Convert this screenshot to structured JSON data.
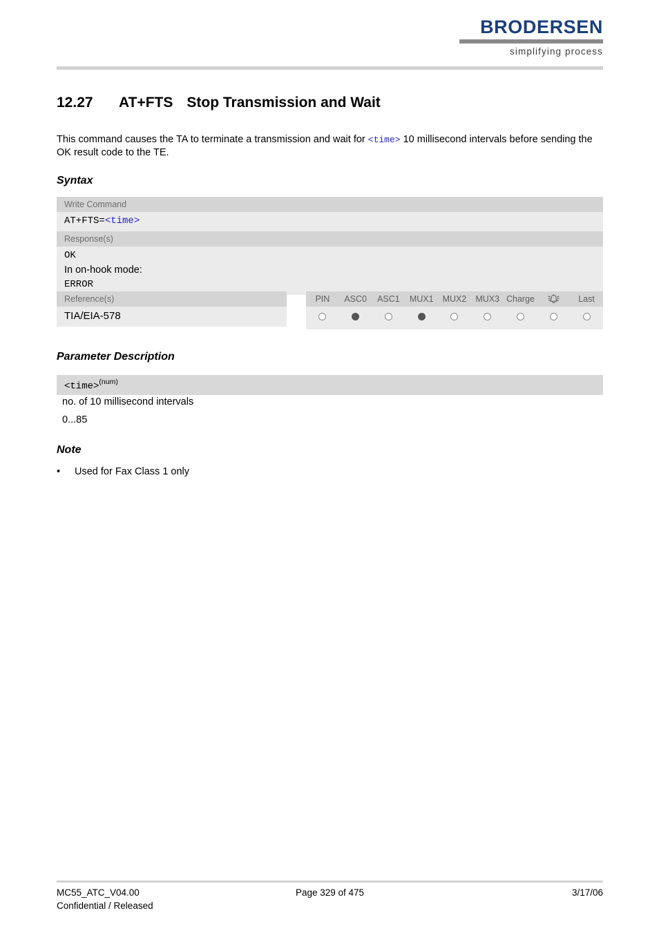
{
  "header": {
    "logo_word": "BRODERSEN",
    "logo_tagline": "simplifying process",
    "logo_color": "#1b3f7a"
  },
  "title": {
    "number": "12.27",
    "command": "AT+FTS",
    "text": "Stop Transmission and Wait"
  },
  "intro": {
    "part1": "This command causes the TA to terminate a transmission and wait for ",
    "param": "<time>",
    "part2": " 10 millisecond intervals before sending the OK result code to the TE."
  },
  "sections": {
    "syntax": "Syntax",
    "parameter_description": "Parameter Description",
    "note": "Note"
  },
  "syntax": {
    "write_command_label": "Write Command",
    "write_command_code_prefix": "AT+FTS=",
    "write_command_code_param": "<time>",
    "responses_label": "Response(s)",
    "response_ok": "OK",
    "response_mode_text": "In on-hook mode:",
    "response_error": "ERROR"
  },
  "reference": {
    "label": "Reference(s)",
    "value": "TIA/EIA-578"
  },
  "capabilities": {
    "columns": [
      {
        "label": "PIN",
        "icon": null,
        "filled": false
      },
      {
        "label": "ASC0",
        "icon": null,
        "filled": true
      },
      {
        "label": "ASC1",
        "icon": null,
        "filled": false
      },
      {
        "label": "MUX1",
        "icon": null,
        "filled": true
      },
      {
        "label": "MUX2",
        "icon": null,
        "filled": false
      },
      {
        "label": "MUX3",
        "icon": null,
        "filled": false
      },
      {
        "label": "Charge",
        "icon": null,
        "filled": false
      },
      {
        "label": "",
        "icon": "alarm-bell-icon",
        "filled": false
      },
      {
        "label": "Last",
        "icon": null,
        "filled": false
      }
    ]
  },
  "parameter": {
    "name": "<time>",
    "type_superscript": "(num)",
    "description": "no. of 10 millisecond intervals",
    "range": "0...85"
  },
  "note": {
    "bullet": "•",
    "text": "Used for Fax Class 1 only"
  },
  "footer": {
    "doc_id": "MC55_ATC_V04.00",
    "classification": "Confidential / Released",
    "page": "Page 329 of 475",
    "date": "3/17/06"
  }
}
